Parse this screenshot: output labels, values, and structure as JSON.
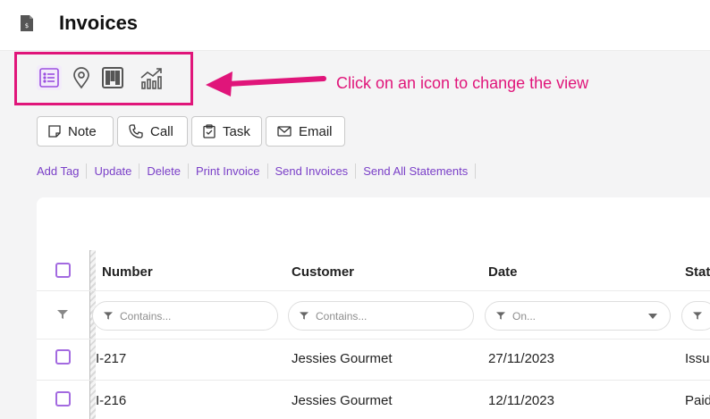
{
  "header": {
    "title": "Invoices",
    "doc_icon": "invoice-document-icon"
  },
  "view_switcher": {
    "icons": [
      "list-view-icon",
      "map-pin-icon",
      "kanban-board-icon",
      "chart-view-icon"
    ],
    "active": "list-view-icon"
  },
  "callout": {
    "text": "Click on an icon to change the view",
    "color": "#e0157a"
  },
  "actions": [
    {
      "label": "Note",
      "icon": "note-icon"
    },
    {
      "label": "Call",
      "icon": "phone-icon"
    },
    {
      "label": "Task",
      "icon": "clipboard-check-icon"
    },
    {
      "label": "Email",
      "icon": "envelope-icon"
    }
  ],
  "links": [
    "Add Tag",
    "Update",
    "Delete",
    "Print Invoice",
    "Send Invoices",
    "Send All Statements"
  ],
  "table": {
    "columns": [
      "Number",
      "Customer",
      "Date",
      "Stat"
    ],
    "filters": [
      "Contains...",
      "Contains...",
      "On...",
      ""
    ],
    "rows": [
      {
        "number": "I-217",
        "customer": "Jessies Gourmet",
        "date": "27/11/2023",
        "status": "Issue"
      },
      {
        "number": "I-216",
        "customer": "Jessies Gourmet",
        "date": "12/11/2023",
        "status": "Paid"
      }
    ]
  },
  "colors": {
    "accent": "#7a3fc8",
    "highlight": "#e0157a"
  }
}
